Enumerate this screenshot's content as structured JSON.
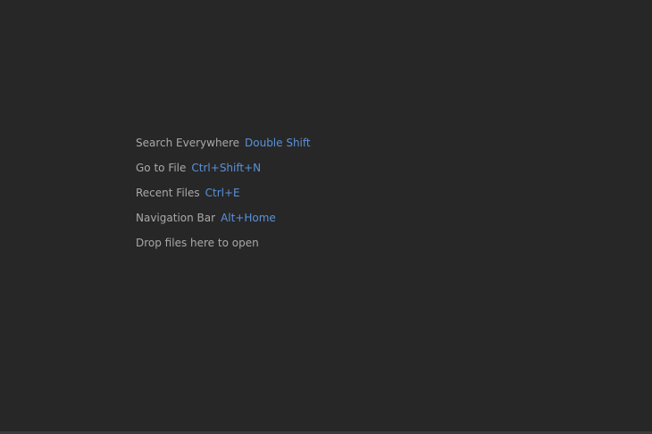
{
  "empty_editor": {
    "hints": [
      {
        "label": "Search Everywhere",
        "shortcut": "Double Shift"
      },
      {
        "label": "Go to File",
        "shortcut": "Ctrl+Shift+N"
      },
      {
        "label": "Recent Files",
        "shortcut": "Ctrl+E"
      },
      {
        "label": "Navigation Bar",
        "shortcut": "Alt+Home"
      },
      {
        "label": "Drop files here to open"
      }
    ]
  },
  "colors": {
    "background": "#272727",
    "label_text": "#a9a9a9",
    "shortcut_text": "#5a92da",
    "bottom_edge": "#3a3a3d"
  }
}
